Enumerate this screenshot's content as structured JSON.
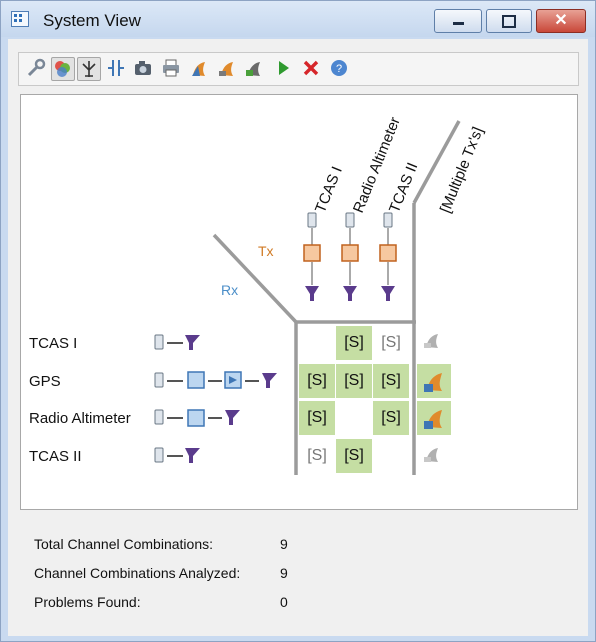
{
  "window": {
    "title": "System View"
  },
  "toolbar": {
    "buttons": [
      "wrench-icon",
      "mixed-color-icon",
      "antenna-pressed-icon",
      "split-icon",
      "camera-icon",
      "printer-icon",
      "fish-blue-orange-icon",
      "fish-orange-icon",
      "fish-green-icon",
      "play-icon",
      "stop-x-icon",
      "help-icon"
    ]
  },
  "diagram": {
    "tx_label": "Tx",
    "rx_label": "Rx",
    "columns": [
      "TCAS I",
      "Radio Altimeter",
      "TCAS II",
      "[Multiple Tx's]"
    ],
    "rows": [
      "TCAS I",
      "GPS",
      "Radio Altimeter",
      "TCAS II"
    ],
    "cells": [
      [
        "",
        "[S]",
        "[S]",
        "gray"
      ],
      [
        "[S]",
        "[S]",
        "[S]",
        "orange"
      ],
      [
        "[S]",
        "",
        "[S]",
        "orange"
      ],
      [
        "[S]",
        "[S]",
        "",
        "gray"
      ]
    ],
    "highlight": [
      [
        false,
        true,
        false,
        false
      ],
      [
        true,
        true,
        true,
        true
      ],
      [
        true,
        false,
        true,
        true
      ],
      [
        false,
        true,
        false,
        false
      ]
    ]
  },
  "summary": {
    "total_label": "Total Channel Combinations:",
    "total_value": "9",
    "analyzed_label": "Channel Combinations Analyzed:",
    "analyzed_value": "9",
    "problems_label": "Problems Found:",
    "problems_value": "0"
  },
  "colors": {
    "highlight": "#c5dea3",
    "tx": "#d07a24",
    "rx": "#4b8ec8",
    "receiver": "#5a3b8c",
    "filter": "#3f76b5"
  }
}
